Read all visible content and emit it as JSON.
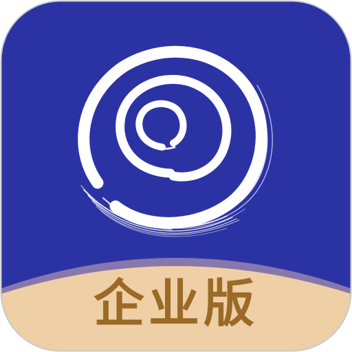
{
  "app_icon": {
    "edition_label": "企业版",
    "logo": "white-brush-swirl-logo",
    "colors": {
      "background": "#2b33a4",
      "bottom_band": "#efcfa5",
      "band_edge": "#8678ad",
      "label": "#9a6a26",
      "swirl": "#ffffff",
      "border": "#c9c9c9"
    }
  }
}
